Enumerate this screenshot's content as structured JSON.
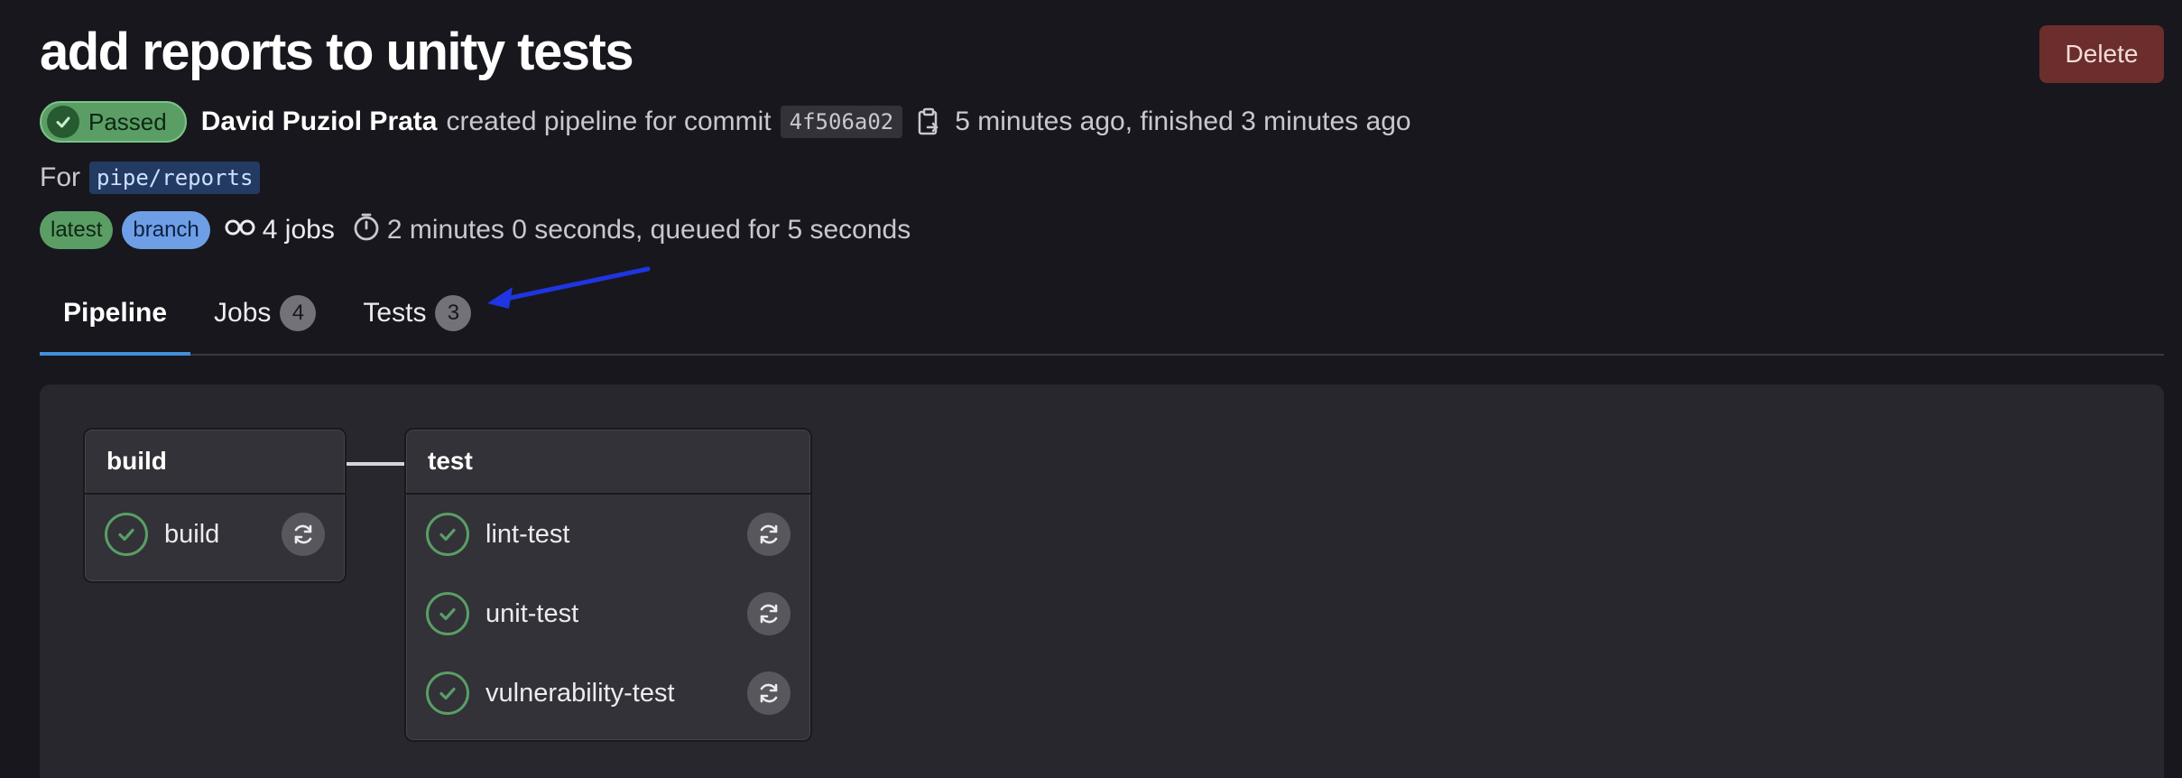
{
  "header": {
    "title": "add reports to unity tests",
    "delete_label": "Delete"
  },
  "meta": {
    "status": "Passed",
    "author": "David Puziol Prata",
    "action": "created pipeline for commit",
    "sha": "4f506a02",
    "time": "5 minutes ago, finished 3 minutes ago"
  },
  "ref": {
    "prefix": "For",
    "name": "pipe/reports"
  },
  "badges": {
    "latest": "latest",
    "branch": "branch",
    "jobs": "4 jobs",
    "duration": "2 minutes 0 seconds, queued for 5 seconds"
  },
  "tabs": [
    {
      "label": "Pipeline",
      "count": null,
      "active": true
    },
    {
      "label": "Jobs",
      "count": "4",
      "active": false
    },
    {
      "label": "Tests",
      "count": "3",
      "active": false
    }
  ],
  "stages": [
    {
      "name": "build",
      "jobs": [
        {
          "name": "build",
          "status": "success"
        }
      ]
    },
    {
      "name": "test",
      "jobs": [
        {
          "name": "lint-test",
          "status": "success"
        },
        {
          "name": "unit-test",
          "status": "success"
        },
        {
          "name": "vulnerability-test",
          "status": "success"
        }
      ]
    }
  ],
  "colors": {
    "success": "#5a9e66",
    "accent": "#428fdc",
    "annotation_arrow": "#1f35e0"
  }
}
